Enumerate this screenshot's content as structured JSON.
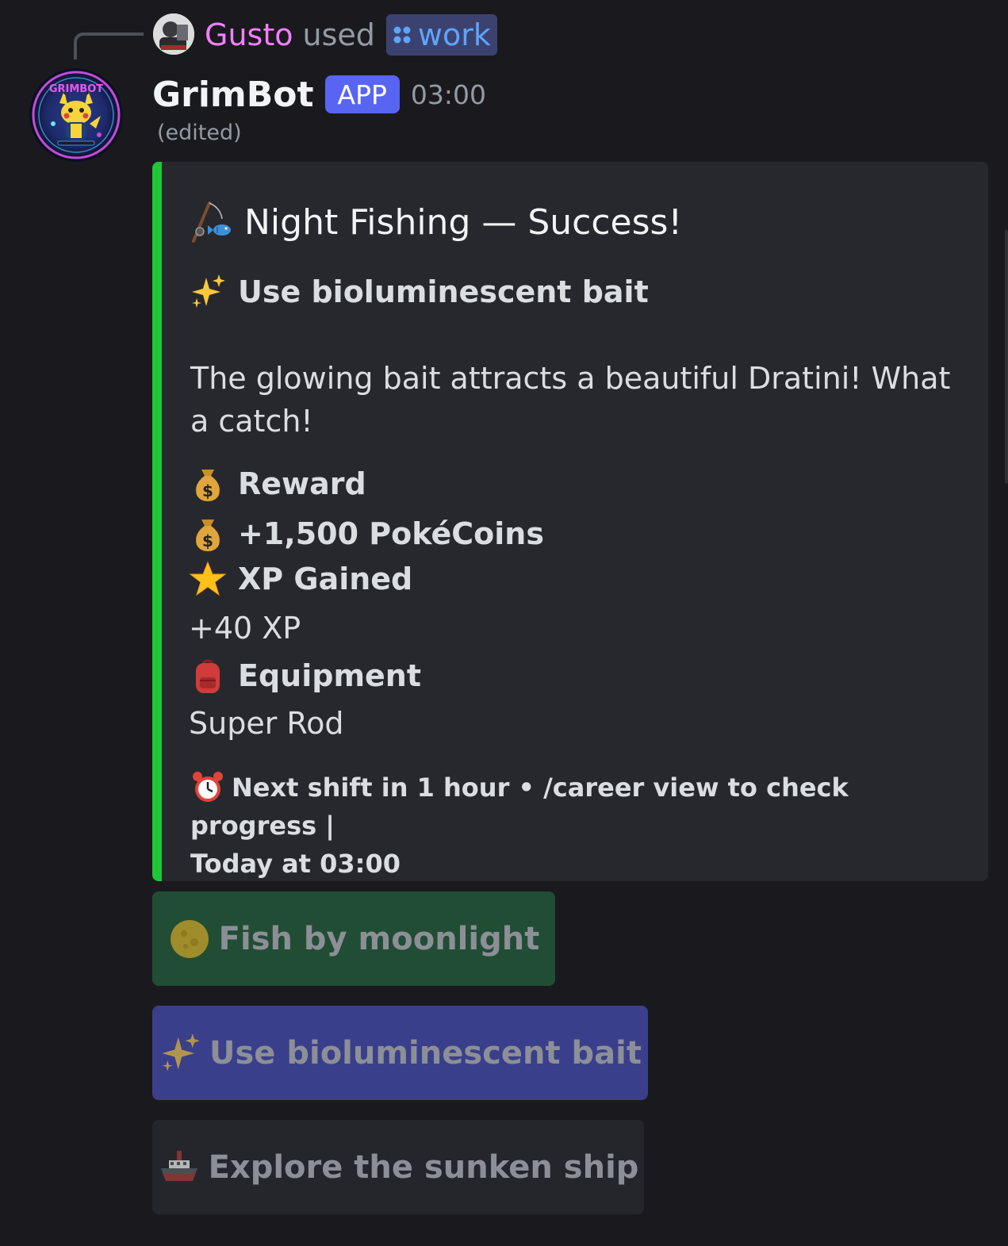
{
  "reply": {
    "user": "Gusto",
    "verb": "used",
    "command": "work",
    "command_icon": "slash-command-icon"
  },
  "message": {
    "author": "GrimBot",
    "tag": "APP",
    "time": "03:00",
    "edited": "(edited)",
    "avatar_text": "GRIMBOT"
  },
  "embed": {
    "accent_color": "#1ec735",
    "title": "Night Fishing — Success!",
    "title_icon": "fishing-pole-icon",
    "subtitle": "Use bioluminescent bait",
    "subtitle_icon": "sparkles-icon",
    "description": "The glowing bait attracts a beautiful Dratini! What a catch!",
    "reward_label": "Reward",
    "reward_icon": "money-bag-icon",
    "reward_value": "+1,500 PokéCoins",
    "xp_label": "XP Gained",
    "xp_icon": "star-icon",
    "xp_value": "+40 XP",
    "equipment_label": "Equipment",
    "equipment_icon": "backpack-icon",
    "equipment_value": "Super Rod",
    "footer_line1": "Next shift in 1 hour • /career view to check progress |",
    "footer_line2": "Today at 03:00",
    "footer_icon": "alarm-clock-icon"
  },
  "buttons": [
    {
      "label": "Fish by moonlight",
      "icon": "full-moon-icon",
      "color": "#214d35"
    },
    {
      "label": "Use bioluminescent bait",
      "icon": "sparkles-icon",
      "color": "#3a3f8c"
    },
    {
      "label": "Explore the sunken ship",
      "icon": "ship-icon",
      "color": "#25262c"
    }
  ],
  "colors": {
    "background": "#1a1a1e",
    "embed_bg": "#27282e",
    "app_tag": "#5865f2",
    "reply_user": "#f47fff",
    "command": "#5ea4ff"
  }
}
